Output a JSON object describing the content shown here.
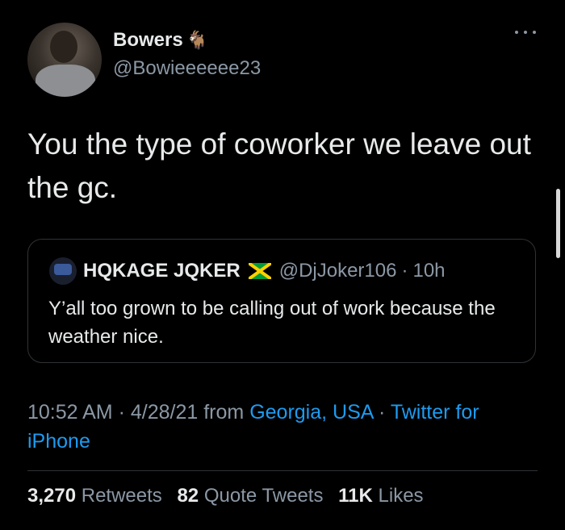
{
  "author": {
    "name": "Bowers",
    "name_emoji": "🐐",
    "handle": "@Bowieeeeee23"
  },
  "tweet": {
    "text": "You the type of coworker we leave out the gc."
  },
  "quoted_tweet": {
    "name": "HQKAGE JQKER",
    "flag": "jamaica-flag",
    "handle": "@DjJoker106",
    "separator": "·",
    "time": "10h",
    "text": "Y’all too grown to be calling out of work because the weather nice."
  },
  "meta": {
    "time": "10:52 AM",
    "dot1": " · ",
    "date": "4/28/21",
    "from": " from ",
    "location": "Georgia, USA",
    "dot2": " · ",
    "source": "Twitter for iPhone"
  },
  "stats": {
    "retweets_count": "3,270",
    "retweets_label": "Retweets",
    "quotes_count": "82",
    "quotes_label": "Quote Tweets",
    "likes_count": "11K",
    "likes_label": "Likes"
  },
  "colors": {
    "background": "#000000",
    "text": "#e7e9ea",
    "secondary": "#8b98a5",
    "link": "#1d9bf0",
    "border": "#2f3336"
  }
}
